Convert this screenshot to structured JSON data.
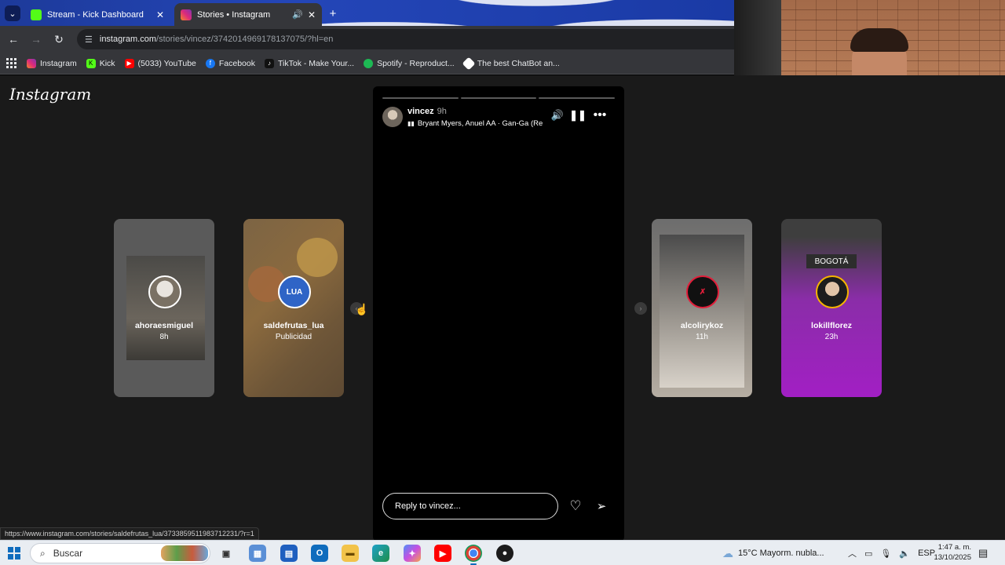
{
  "browser": {
    "tabs": [
      {
        "title": "Stream - Kick Dashboard",
        "active": false,
        "favicon_color": "#53fc18"
      },
      {
        "title": "Stories • Instagram",
        "active": true,
        "favicon_color": "#e1306c"
      }
    ],
    "url_host": "instagram.com",
    "url_path": "/stories/vincez/3742014969178137075/?hl=en",
    "bookmarks": [
      {
        "label": "Instagram",
        "color": "#e1306c"
      },
      {
        "label": "Kick",
        "color": "#53fc18"
      },
      {
        "label": "(5033) YouTube",
        "color": "#ff0000"
      },
      {
        "label": "Facebook",
        "color": "#1877f2"
      },
      {
        "label": "TikTok - Make Your...",
        "color": "#111111"
      },
      {
        "label": "Spotify - Reproduct...",
        "color": "#1db954"
      },
      {
        "label": "The best ChatBot an...",
        "color": "#ffffff"
      }
    ],
    "status_url": "https://www.instagram.com/stories/saldefrutas_lua/3733859511983712231/?r=1"
  },
  "instagram": {
    "logo": "Instagram",
    "stories": [
      {
        "user": "ahoraesmiguel",
        "sub": "8h"
      },
      {
        "user": "saldefrutas_lua",
        "sub": "Publicidad",
        "avatar_text": "LUA"
      },
      {
        "user": "alcolirykoz",
        "sub": "11h"
      },
      {
        "user": "lokillflorez",
        "sub": "23h",
        "tag": "BOGOTÁ"
      }
    ],
    "viewer": {
      "user": "vincez",
      "time": "9h",
      "song": "Bryant Myers, Anuel AA · Gan-Ga (Re",
      "reply_placeholder": "Reply to vincez..."
    }
  },
  "taskbar": {
    "search": "Buscar",
    "weather": "15°C  Mayorm. nubla...",
    "lang": "ESP",
    "time": "1:47 a. m.",
    "date": "13/10/2025"
  }
}
